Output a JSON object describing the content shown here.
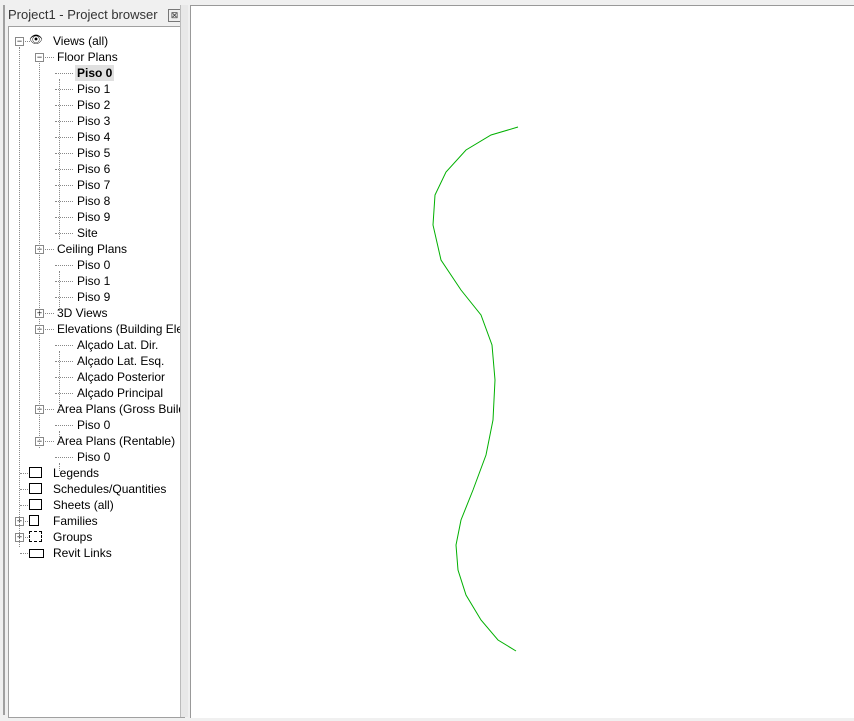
{
  "browser": {
    "title": "Project1 - Project browser",
    "close": "⊠"
  },
  "tree": [
    {
      "label": "Views (all)",
      "level": 0,
      "exp": "-",
      "icon": "eye"
    },
    {
      "label": "Floor Plans",
      "level": 1,
      "exp": "-"
    },
    {
      "label": "Piso 0",
      "level": 2,
      "selected": true
    },
    {
      "label": "Piso 1",
      "level": 2
    },
    {
      "label": "Piso 2",
      "level": 2
    },
    {
      "label": "Piso 3",
      "level": 2
    },
    {
      "label": "Piso 4",
      "level": 2
    },
    {
      "label": "Piso 5",
      "level": 2
    },
    {
      "label": "Piso 6",
      "level": 2
    },
    {
      "label": "Piso 7",
      "level": 2
    },
    {
      "label": "Piso 8",
      "level": 2
    },
    {
      "label": "Piso 9",
      "level": 2
    },
    {
      "label": "Site",
      "level": 2
    },
    {
      "label": "Ceiling Plans",
      "level": 1,
      "exp": "-"
    },
    {
      "label": "Piso 0",
      "level": 2
    },
    {
      "label": "Piso 1",
      "level": 2
    },
    {
      "label": "Piso 9",
      "level": 2
    },
    {
      "label": "3D Views",
      "level": 1,
      "exp": "+"
    },
    {
      "label": "Elevations (Building Elevation)",
      "level": 1,
      "exp": "-"
    },
    {
      "label": "Alçado Lat. Dir.",
      "level": 2
    },
    {
      "label": "Alçado Lat. Esq.",
      "level": 2
    },
    {
      "label": "Alçado Posterior",
      "level": 2
    },
    {
      "label": "Alçado Principal",
      "level": 2
    },
    {
      "label": "Area Plans (Gross Building)",
      "level": 1,
      "exp": "-"
    },
    {
      "label": "Piso 0",
      "level": 2
    },
    {
      "label": "Area Plans (Rentable)",
      "level": 1,
      "exp": "-"
    },
    {
      "label": "Piso 0",
      "level": 2
    },
    {
      "label": "Legends",
      "level": 0,
      "icon": "legend"
    },
    {
      "label": "Schedules/Quantities",
      "level": 0,
      "icon": "schedule"
    },
    {
      "label": "Sheets (all)",
      "level": 0,
      "icon": "sheet"
    },
    {
      "label": "Families",
      "level": 0,
      "exp": "+",
      "icon": "family"
    },
    {
      "label": "Groups",
      "level": 0,
      "exp": "+",
      "icon": "group"
    },
    {
      "label": "Revit Links",
      "level": 0,
      "icon": "link"
    }
  ],
  "curve_color": "#00b000"
}
